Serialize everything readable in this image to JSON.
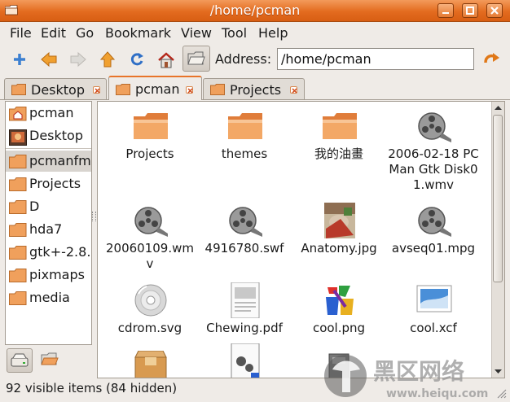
{
  "window": {
    "title": "/home/pcman"
  },
  "menu": [
    "File",
    "Edit",
    "Go",
    "Bookmark",
    "View",
    "Tool",
    "Help"
  ],
  "toolbar": {
    "buttons": [
      "new-tab",
      "back",
      "forward",
      "up",
      "reload",
      "home",
      "open-folder"
    ],
    "address_label": "Address:",
    "address_value": "/home/pcman"
  },
  "tabs": [
    {
      "label": "Desktop",
      "active": false
    },
    {
      "label": "pcman",
      "active": true
    },
    {
      "label": "Projects",
      "active": false
    }
  ],
  "sidebar": {
    "items": [
      {
        "label": "pcman",
        "icon": "home-folder-icon",
        "selected": false
      },
      {
        "label": "Desktop",
        "icon": "desktop-icon",
        "selected": false
      },
      {
        "label": "pcmanfm",
        "icon": "folder-icon",
        "selected": true
      },
      {
        "label": "Projects",
        "icon": "folder-icon",
        "selected": false
      },
      {
        "label": "D",
        "icon": "folder-icon",
        "selected": false
      },
      {
        "label": "hda7",
        "icon": "folder-icon",
        "selected": false
      },
      {
        "label": "gtk+-2.8.",
        "icon": "folder-icon",
        "selected": false
      },
      {
        "label": "pixmaps",
        "icon": "folder-icon",
        "selected": false
      },
      {
        "label": "media",
        "icon": "folder-icon",
        "selected": false
      }
    ],
    "mode_buttons": [
      "drive-icon",
      "folder-tree-icon"
    ]
  },
  "files": [
    {
      "name": "Projects",
      "icon": "folder-icon"
    },
    {
      "name": "themes",
      "icon": "folder-icon"
    },
    {
      "name": "我的油畫",
      "icon": "folder-icon"
    },
    {
      "name": "2006-02-18 PCMan Gtk Disk01.wmv",
      "icon": "video-reel-icon"
    },
    {
      "name": "20060109.wmv",
      "icon": "video-reel-icon"
    },
    {
      "name": "4916780.swf",
      "icon": "video-reel-icon"
    },
    {
      "name": "Anatomy.jpg",
      "icon": "photo-thumbnail-icon"
    },
    {
      "name": "avseq01.mpg",
      "icon": "video-reel-icon"
    },
    {
      "name": "cdrom.svg",
      "icon": "cdrom-icon"
    },
    {
      "name": "Chewing.pdf",
      "icon": "pdf-document-icon"
    },
    {
      "name": "cool.png",
      "icon": "image-png-icon"
    },
    {
      "name": "cool.xcf",
      "icon": "xcf-image-icon"
    },
    {
      "name": "",
      "icon": "package-box-icon"
    },
    {
      "name": "",
      "icon": "script-document-icon"
    },
    {
      "name": "",
      "icon": "tool-icon"
    }
  ],
  "status": {
    "text": "92 visible items (84 hidden)"
  },
  "watermark": {
    "cn": "黑区网络",
    "url": "www.heiqu.com"
  },
  "colors": {
    "accent": "#e36b1f",
    "folder": "#f0a05c",
    "selection": "#d8d4cf"
  }
}
